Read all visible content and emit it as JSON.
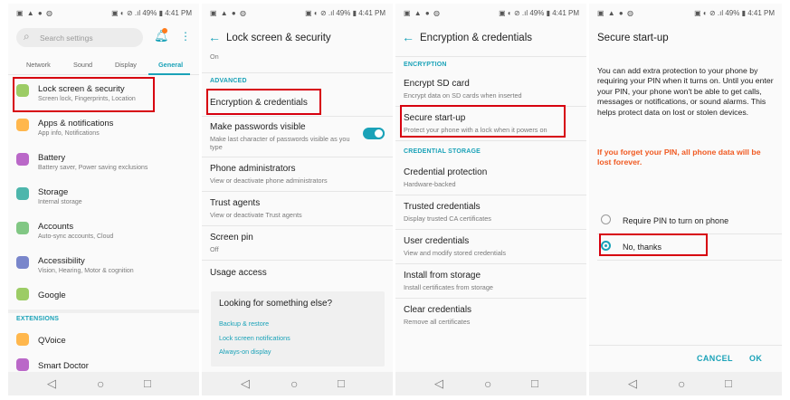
{
  "status_bar": {
    "left_icons": "▣ ▲ ● ◍",
    "right": "▣ ◐ ⊘ .ıl 49% ▮ 4:41 PM",
    "right_p4": "▣ ◐ ⊘ .ıl 49% ▮ 4:41 PM"
  },
  "nav": {
    "back": "◁",
    "home": "○",
    "recent": "□"
  },
  "panel1": {
    "search_placeholder": "Search settings",
    "tabs": [
      "Network",
      "Sound",
      "Display",
      "General"
    ],
    "items": [
      {
        "title": "Lock screen & security",
        "subtitle": "Screen lock, Fingerprints, Location",
        "color": "#9ccc65"
      },
      {
        "title": "Apps & notifications",
        "subtitle": "App info, Notifications",
        "color": "#ffb74d"
      },
      {
        "title": "Battery",
        "subtitle": "Battery saver, Power saving exclusions",
        "color": "#ba68c8"
      },
      {
        "title": "Storage",
        "subtitle": "Internal storage",
        "color": "#4db6ac"
      },
      {
        "title": "Accounts",
        "subtitle": "Auto-sync accounts, Cloud",
        "color": "#81c784"
      },
      {
        "title": "Accessibility",
        "subtitle": "Vision, Hearing, Motor & cognition",
        "color": "#7986cb"
      },
      {
        "title": "Google",
        "subtitle": "",
        "color": "#9ccc65"
      }
    ],
    "extensions_header": "EXTENSIONS",
    "ext_items": [
      {
        "title": "QVoice",
        "color": "#ffb74d"
      },
      {
        "title": "Smart Doctor",
        "color": "#ba68c8"
      }
    ]
  },
  "panel2": {
    "title": "Lock screen & security",
    "top_value": "On",
    "section": "ADVANCED",
    "items": [
      {
        "title": "Encryption & credentials",
        "subtitle": ""
      },
      {
        "title": "Make passwords visible",
        "subtitle": "Make last character of passwords visible as you type"
      },
      {
        "title": "Phone administrators",
        "subtitle": "View or deactivate phone administrators"
      },
      {
        "title": "Trust agents",
        "subtitle": "View or deactivate Trust agents"
      },
      {
        "title": "Screen pin",
        "subtitle": "Off"
      },
      {
        "title": "Usage access",
        "subtitle": ""
      }
    ],
    "card": {
      "question": "Looking for something else?",
      "links": [
        "Backup & restore",
        "Lock screen notifications",
        "Always-on display"
      ]
    }
  },
  "panel3": {
    "title": "Encryption & credentials",
    "section1": "ENCRYPTION",
    "section2": "CREDENTIAL STORAGE",
    "items": [
      {
        "title": "Encrypt SD card",
        "subtitle": "Encrypt data on SD cards when inserted"
      },
      {
        "title": "Secure start-up",
        "subtitle": "Protect your phone with a lock when it powers on"
      },
      {
        "title": "Credential protection",
        "subtitle": "Hardware-backed"
      },
      {
        "title": "Trusted credentials",
        "subtitle": "Display trusted CA certificates"
      },
      {
        "title": "User credentials",
        "subtitle": "View and modify stored credentials"
      },
      {
        "title": "Install from storage",
        "subtitle": "Install certificates from storage"
      },
      {
        "title": "Clear credentials",
        "subtitle": "Remove all certificates"
      }
    ]
  },
  "panel4": {
    "title": "Secure start-up",
    "body": "You can add extra protection to your phone by requiring your PIN when it turns on. Until you enter your PIN, your phone won't be able to get calls, messages or notifications, or sound alarms. This helps protect data on lost or stolen devices.",
    "warning": "If you forget your PIN, all phone data will be lost forever.",
    "options": [
      "Require PIN to turn on phone",
      "No, thanks"
    ],
    "selected": "No, thanks",
    "cancel": "CANCEL",
    "ok": "OK"
  },
  "colors": {
    "accent": "#1aa2b8",
    "highlight": "#d7000f",
    "warning": "#f05a22"
  }
}
